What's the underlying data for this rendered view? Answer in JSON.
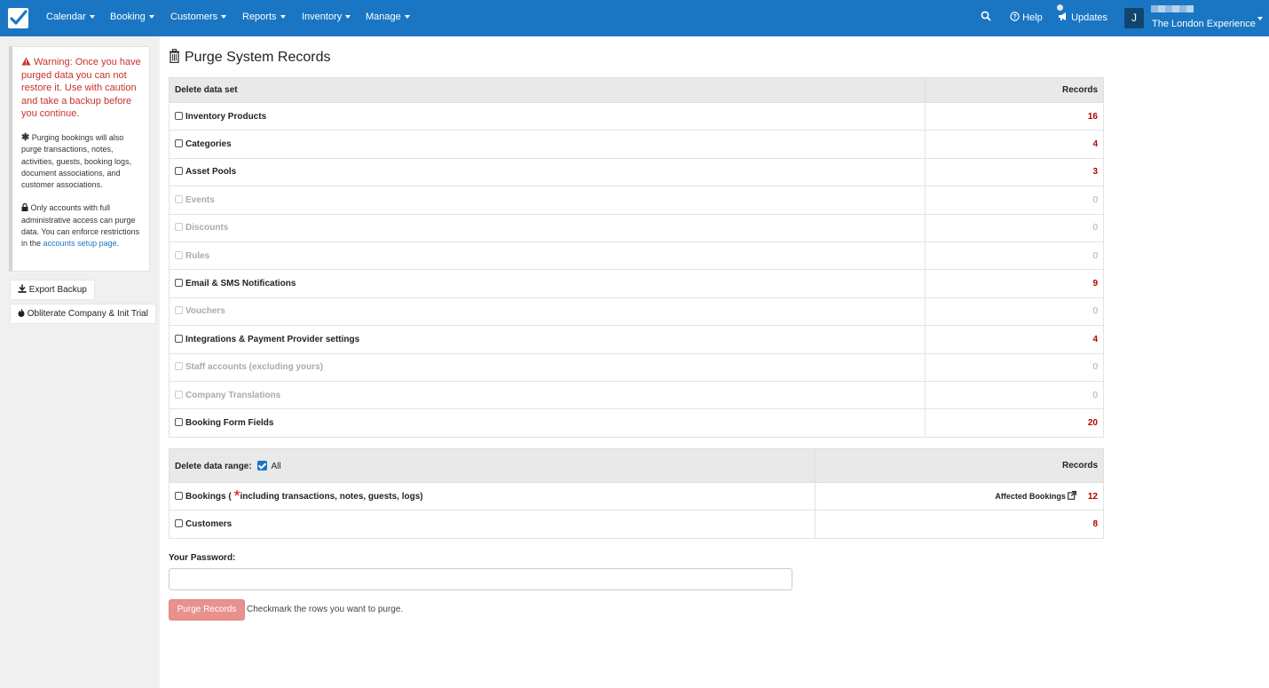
{
  "nav": {
    "items": [
      {
        "label": "Calendar"
      },
      {
        "label": "Booking"
      },
      {
        "label": "Customers"
      },
      {
        "label": "Reports"
      },
      {
        "label": "Inventory"
      },
      {
        "label": "Manage"
      }
    ],
    "help": "Help",
    "updates": "Updates",
    "avatar_initial": "J",
    "company": "The London Experience"
  },
  "sidebar": {
    "warning": "Warning: Once you have purged data you can not restore it. Use with caution and take a backup before you continue.",
    "note_bookings": "Purging bookings will also purge transactions, notes, activities, guests, booking logs, document associations, and customer associations.",
    "note_access": "Only accounts with full administrative access can purge data. You can enforce restrictions in the",
    "note_access_link": "accounts setup page",
    "note_access_end": ".",
    "export_button": "Export Backup",
    "obliterate_button": "Obliterate Company & Init Trial"
  },
  "main": {
    "title": "Purge System Records",
    "data_set": {
      "header_label": "Delete data set",
      "header_records": "Records",
      "rows": [
        {
          "label": "Inventory Products",
          "count": "16",
          "enabled": true
        },
        {
          "label": "Categories",
          "count": "4",
          "enabled": true
        },
        {
          "label": "Asset Pools",
          "count": "3",
          "enabled": true
        },
        {
          "label": "Events",
          "count": "0",
          "enabled": false
        },
        {
          "label": "Discounts",
          "count": "0",
          "enabled": false
        },
        {
          "label": "Rules",
          "count": "0",
          "enabled": false
        },
        {
          "label": "Email & SMS Notifications",
          "count": "9",
          "enabled": true
        },
        {
          "label": "Vouchers",
          "count": "0",
          "enabled": false
        },
        {
          "label": "Integrations & Payment Provider settings",
          "count": "4",
          "enabled": true
        },
        {
          "label": "Staff accounts (excluding yours)",
          "count": "0",
          "enabled": false
        },
        {
          "label": "Company Translations",
          "count": "0",
          "enabled": false
        },
        {
          "label": "Booking Form Fields",
          "count": "20",
          "enabled": true
        }
      ]
    },
    "data_range": {
      "header_label": "Delete data range:",
      "all_label": "All",
      "all_checked": true,
      "header_records": "Records",
      "bookings_label_start": "Bookings (",
      "bookings_star": "*",
      "bookings_label_end": "including transactions, notes, guests, logs)",
      "affected_link": "Affected Bookings",
      "bookings_count": "12",
      "customers_label": "Customers",
      "customers_count": "8"
    },
    "password_label": "Your Password:",
    "password_value": "",
    "purge_button": "Purge Records",
    "hint": "Checkmark the rows you want to purge."
  }
}
